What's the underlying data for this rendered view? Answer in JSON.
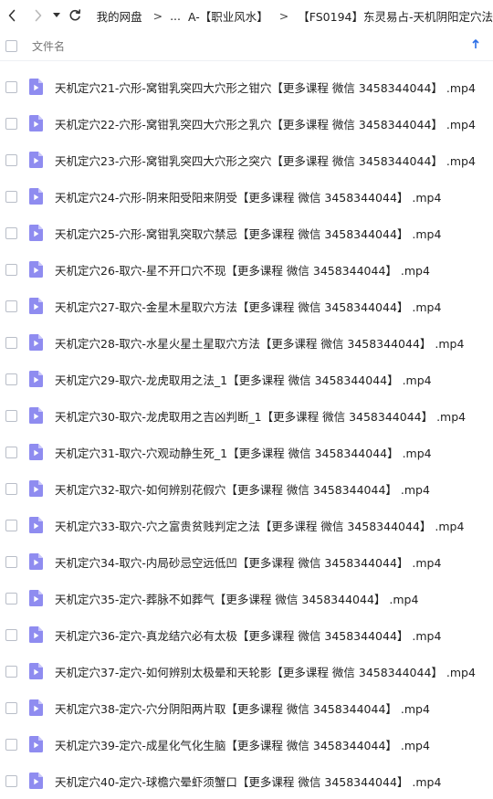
{
  "breadcrumb": {
    "items": [
      "我的网盘",
      "...",
      "A-【职业风水】",
      "【FS0194】东灵易占-天机阴阳定穴法"
    ],
    "separator": ">"
  },
  "table": {
    "column_name": "文件名",
    "files": [
      "天机定穴21-穴形-窝钳乳突四大穴形之钳穴【更多课程 微信 3458344044】 .mp4",
      "天机定穴22-穴形-窝钳乳突四大穴形之乳穴【更多课程 微信 3458344044】 .mp4",
      "天机定穴23-穴形-窝钳乳突四大穴形之突穴【更多课程 微信 3458344044】 .mp4",
      "天机定穴24-穴形-阴来阳受阳来阴受【更多课程 微信 3458344044】 .mp4",
      "天机定穴25-穴形-窝钳乳突取穴禁忌【更多课程 微信 3458344044】 .mp4",
      "天机定穴26-取穴-星不开口穴不现【更多课程 微信 3458344044】 .mp4",
      "天机定穴27-取穴-金星木星取穴方法【更多课程 微信 3458344044】 .mp4",
      "天机定穴28-取穴-水星火星土星取穴方法【更多课程 微信 3458344044】 .mp4",
      "天机定穴29-取穴-龙虎取用之法_1【更多课程 微信 3458344044】 .mp4",
      "天机定穴30-取穴-龙虎取用之吉凶判断_1【更多课程 微信 3458344044】 .mp4",
      "天机定穴31-取穴-穴观动静生死_1【更多课程 微信 3458344044】 .mp4",
      "天机定穴32-取穴-如何辨别花假穴【更多课程 微信 3458344044】 .mp4",
      "天机定穴33-取穴-穴之富贵贫贱判定之法【更多课程 微信 3458344044】 .mp4",
      "天机定穴34-取穴-内局砂忌空远低凹【更多课程 微信 3458344044】 .mp4",
      "天机定穴35-定穴-葬脉不如葬气【更多课程 微信 3458344044】 .mp4",
      "天机定穴36-定穴-真龙结穴必有太极【更多课程 微信 3458344044】 .mp4",
      "天机定穴37-定穴-如何辨别太极晕和天轮影【更多课程 微信 3458344044】 .mp4",
      "天机定穴38-定穴-穴分阴阳两片取【更多课程 微信 3458344044】 .mp4",
      "天机定穴39-定穴-成星化气化生脑【更多课程 微信 3458344044】 .mp4",
      "天机定穴40-定穴-球檐穴晕虾须蟹口【更多课程 微信 3458344044】 .mp4"
    ]
  },
  "colors": {
    "file_icon": "#8f8cf0",
    "accent": "#2b6ee6"
  },
  "icons": {
    "back": "chevron-left-icon",
    "forward": "chevron-right-icon",
    "dropdown": "caret-down-icon",
    "refresh": "refresh-icon",
    "sort": "arrow-up-icon",
    "file": "video-file-icon"
  }
}
